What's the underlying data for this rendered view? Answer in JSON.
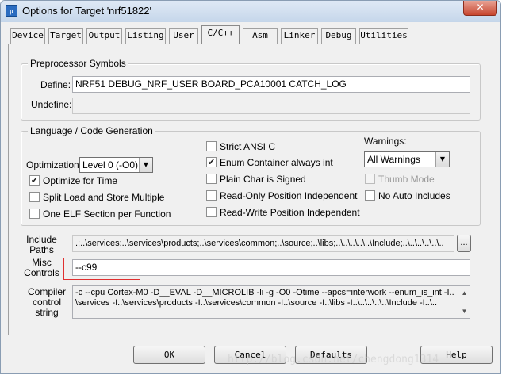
{
  "window": {
    "title": "Options for Target 'nrf51822'",
    "icon_text": "μ",
    "close_icon": "✕"
  },
  "tabs": [
    {
      "label": "Device",
      "active": false
    },
    {
      "label": "Target",
      "active": false
    },
    {
      "label": "Output",
      "active": false
    },
    {
      "label": "Listing",
      "active": false
    },
    {
      "label": "User",
      "active": false
    },
    {
      "label": "C/C++",
      "active": true
    },
    {
      "label": "Asm",
      "active": false
    },
    {
      "label": "Linker",
      "active": false
    },
    {
      "label": "Debug",
      "active": false
    },
    {
      "label": "Utilities",
      "active": false
    }
  ],
  "preprocessor": {
    "group_title": "Preprocessor Symbols",
    "define_label": "Define:",
    "define_value": "NRF51 DEBUG_NRF_USER BOARD_PCA10001 CATCH_LOG",
    "undefine_label": "Undefine:",
    "undefine_value": ""
  },
  "language": {
    "group_title": "Language / Code Generation",
    "optimization_label": "Optimization:",
    "optimization_value": "Level 0 (-O0)",
    "warnings_label": "Warnings:",
    "warnings_value": "All Warnings",
    "checkboxes": [
      {
        "label": "Optimize for Time",
        "checked": true,
        "enabled": true
      },
      {
        "label": "Split Load and Store Multiple",
        "checked": false,
        "enabled": true
      },
      {
        "label": "One ELF Section per Function",
        "checked": false,
        "enabled": true
      },
      {
        "label": "Strict ANSI C",
        "checked": false,
        "enabled": true
      },
      {
        "label": "Enum Container always int",
        "checked": true,
        "enabled": true
      },
      {
        "label": "Plain Char is Signed",
        "checked": false,
        "enabled": true
      },
      {
        "label": "Read-Only Position Independent",
        "checked": false,
        "enabled": true
      },
      {
        "label": "Read-Write Position Independent",
        "checked": false,
        "enabled": true
      },
      {
        "label": "Thumb Mode",
        "checked": false,
        "enabled": false
      },
      {
        "label": "No Auto Includes",
        "checked": false,
        "enabled": true
      }
    ],
    "check_mark": "✔",
    "dropdown_icon": "▼"
  },
  "include_paths": {
    "label": "Include\nPaths",
    "value": ".;..\\services;..\\services\\products;..\\services\\common;..\\source;..\\libs;..\\..\\..\\..\\..\\Include;..\\..\\..\\..\\..\\..",
    "browse_label": "..."
  },
  "misc_controls": {
    "label": "Misc\nControls",
    "value": "--c99"
  },
  "compiler_control": {
    "label": "Compiler\ncontrol\nstring",
    "line1": "-c --cpu Cortex-M0 -D__EVAL -D__MICROLIB -li -g -O0 -Otime --apcs=interwork --enum_is_int -I.. -I..",
    "line2": "\\services -I..\\services\\products -I..\\services\\common -I..\\source -I..\\libs -I..\\..\\..\\..\\..\\Include -I..\\.."
  },
  "buttons": {
    "ok": "OK",
    "cancel": "Cancel",
    "defaults": "Defaults",
    "help": "Help"
  },
  "watermark": "http://blog.csdn.net/chengdong1314"
}
